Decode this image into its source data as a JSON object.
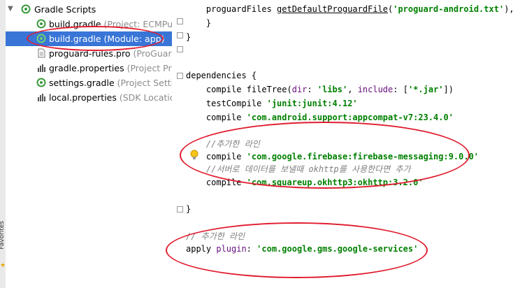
{
  "tree": {
    "root": {
      "label": "Gradle Scripts"
    },
    "items": [
      {
        "name": "build.gradle",
        "hint": " (Project: ECMPu",
        "icon": "gradle-icon"
      },
      {
        "name": "build.gradle",
        "hint": " (Module: app)",
        "icon": "gradle-icon",
        "selected": true
      },
      {
        "name": "proguard-rules.pro",
        "hint": " (ProGuard",
        "icon": "file-icon"
      },
      {
        "name": "gradle.properties",
        "hint": " (Project Pro",
        "icon": "properties-icon"
      },
      {
        "name": "settings.gradle",
        "hint": " (Project Settin",
        "icon": "gradle-icon"
      },
      {
        "name": "local.properties",
        "hint": " (SDK Location",
        "icon": "properties-icon"
      }
    ]
  },
  "side_label": "Favorites",
  "editor": {
    "lines": {
      "l1_prefix": "    proguardFiles ",
      "l1_fn": "getDefaultProguardFile",
      "l1_open": "(",
      "l1_str": "'proguard-android.txt'",
      "l1_close": "),",
      "l2": "    }",
      "l3": "}",
      "dep_open": "dependencies {",
      "c1_kw": "    compile ",
      "c1_rest_a": "fileTree(",
      "c1_dir": "dir",
      "c1_rest_b": ": ",
      "c1_libs": "'libs'",
      "c1_rest_c": ", ",
      "c1_inc": "include",
      "c1_rest_d": ": [",
      "c1_jar": "'*.jar'",
      "c1_rest_e": "])",
      "t1_kw": "    testCompile ",
      "t1_str": "'junit:junit:4.12'",
      "c2_kw": "    compile ",
      "c2_str": "'com.android.support:appcompat-v7:23.4.0'",
      "cm1": "    //추가한 라인",
      "c3_kw": "    compile ",
      "c3_str": "'com.google.firebase:firebase-messaging:9.0.0'",
      "cm2": "    //서버로 데이터를 보낼때 okhttp를 사용한다면 추가",
      "c4_kw": "    compile ",
      "c4_str": "'com.squareup.okhttp3:okhttp:3.2.0'",
      "dep_close": "}",
      "cm3": "// 추가한 라인",
      "ap_kw": "apply ",
      "ap_pl": "plugin",
      "ap_colon": ": ",
      "ap_str": "'com.google.gms.google-services'"
    }
  },
  "colors": {
    "annotation": "#e01d2f",
    "selection": "#3875d7",
    "string": "#008000",
    "keyword": "#000080"
  }
}
